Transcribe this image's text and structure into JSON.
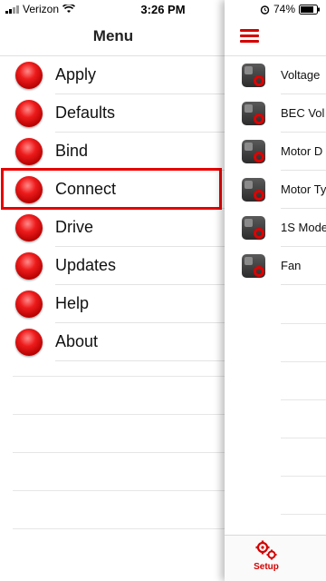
{
  "status_bar": {
    "carrier": "Verizon",
    "time": "3:26 PM",
    "battery": "74%"
  },
  "menu": {
    "title": "Menu",
    "items": [
      {
        "label": "Apply"
      },
      {
        "label": "Defaults"
      },
      {
        "label": "Bind"
      },
      {
        "label": "Connect",
        "selected": true
      },
      {
        "label": "Drive"
      },
      {
        "label": "Updates"
      },
      {
        "label": "Help"
      },
      {
        "label": "About"
      }
    ]
  },
  "setup": {
    "items": [
      {
        "label": "Voltage"
      },
      {
        "label": "BEC Vol"
      },
      {
        "label": "Motor D"
      },
      {
        "label": "Motor Ty"
      },
      {
        "label": "1S Mode"
      },
      {
        "label": "Fan"
      }
    ],
    "tab_label": "Setup"
  },
  "colors": {
    "accent": "#d40000",
    "highlight_border": "#e60000"
  }
}
